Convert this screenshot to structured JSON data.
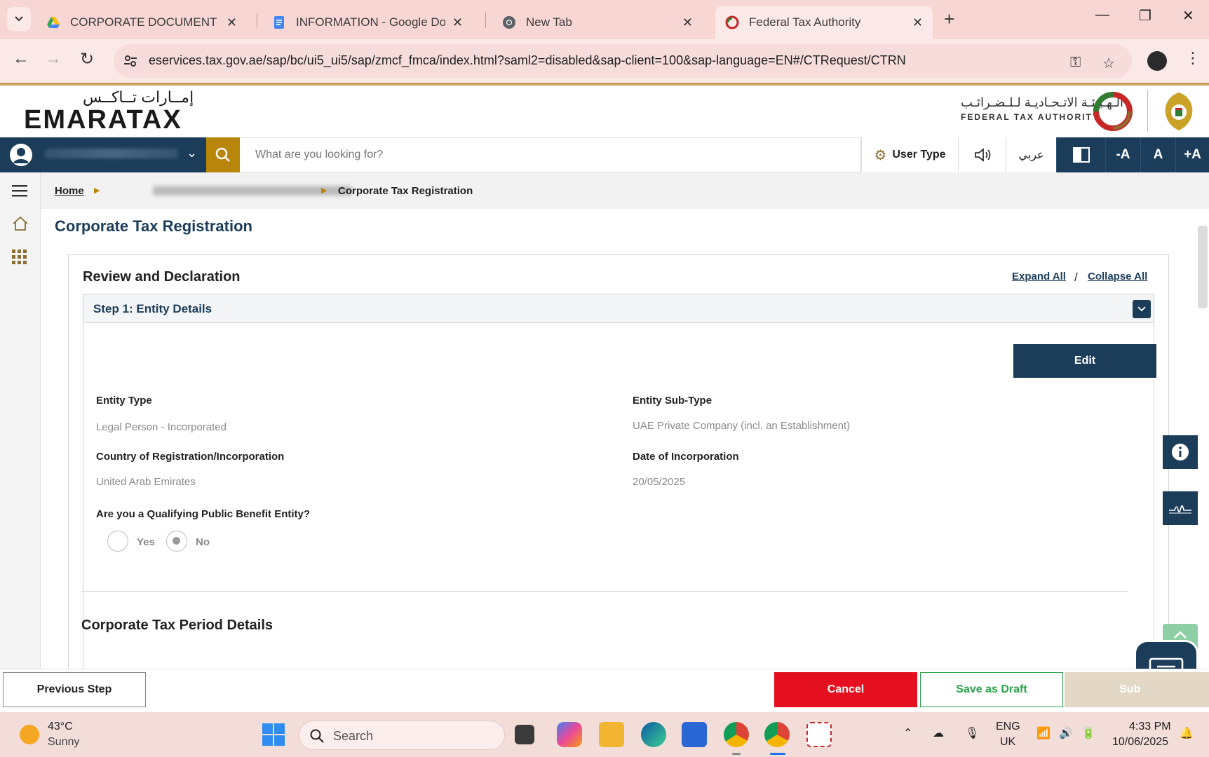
{
  "browser": {
    "tabs": [
      {
        "title": "CORPORATE DOCUMENT - Acc",
        "icon": "google-drive-icon"
      },
      {
        "title": "INFORMATION - Google Docs",
        "icon": "google-docs-icon"
      },
      {
        "title": "New Tab",
        "icon": "chrome-icon"
      },
      {
        "title": "Federal Tax Authority",
        "icon": "fta-icon",
        "active": true
      }
    ],
    "url": "eservices.tax.gov.ae/sap/bc/ui5_ui5/sap/zmcf_fmca/index.html?saml2=disabled&sap-client=100&sap-language=EN#/CTRequest/CTRN"
  },
  "header": {
    "logo_ar": "إمــارات تــاكــس",
    "logo_en": "EMARATAX",
    "fta_ar": "الـهـيـئـة الاتـحـاديـة لـلـضـرائـب",
    "fta_en": "FEDERAL TAX AUTHORITY"
  },
  "navbar": {
    "search_placeholder": "What are you looking for?",
    "user_type": "User Type",
    "arabic": "عربي",
    "font_decrease": "-A",
    "font_normal": "A",
    "font_increase": "+A"
  },
  "breadcrumb": {
    "home": "Home",
    "current": "Corporate Tax Registration"
  },
  "page": {
    "title": "Corporate Tax Registration",
    "card_title": "Review and Declaration",
    "expand_all": "Expand All",
    "slash": "/",
    "collapse_all": "Collapse All",
    "step_title": "Step 1: Entity Details",
    "edit": "Edit",
    "fields": {
      "entity_type_label": "Entity Type",
      "entity_type_value": "Legal Person - Incorporated",
      "entity_subtype_label": "Entity Sub-Type",
      "entity_subtype_value": "UAE Private Company (incl. an Establishment)",
      "country_label": "Country of Registration/Incorporation",
      "country_value": "United Arab Emirates",
      "doi_label": "Date of Incorporation",
      "doi_value": "20/05/2025",
      "qpbe_label": "Are you a Qualifying Public Benefit Entity?",
      "qpbe_yes": "Yes",
      "qpbe_no": "No",
      "qpbe_selected": "No"
    },
    "next_section": "Corporate Tax Period Details"
  },
  "footer": {
    "previous": "Previous Step",
    "cancel": "Cancel",
    "save_draft": "Save as Draft",
    "submit": "Sub"
  },
  "taskbar": {
    "temp": "43°C",
    "condition": "Sunny",
    "search": "Search",
    "lang1": "ENG",
    "lang2": "UK",
    "time": "4:33 PM",
    "date": "10/06/2025"
  },
  "colors": {
    "navy": "#1c3d5a",
    "gold": "#b8860b",
    "cancel_red": "#e5101f",
    "draft_green": "#2aa24a"
  }
}
